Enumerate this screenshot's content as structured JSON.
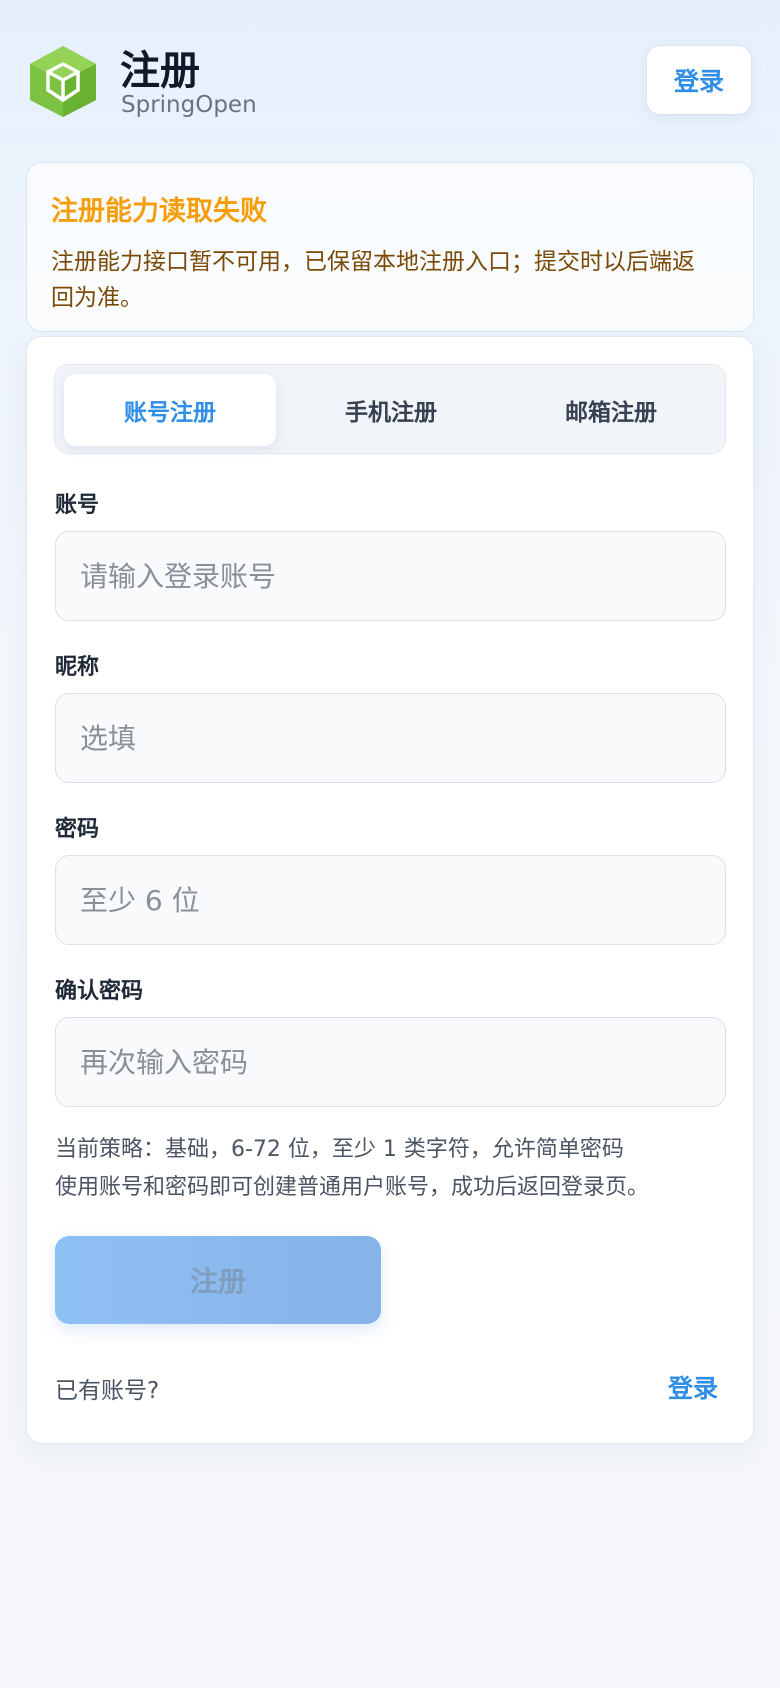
{
  "header": {
    "title": "注册",
    "subtitle": "SpringOpen",
    "login_label": "登录",
    "logo_icon": "cube-logo-icon"
  },
  "alert": {
    "title": "注册能力读取失败",
    "body_line1": "注册能力接口暂不可用，已保留本地注册入口；提交时以后端返",
    "body_line2": "回为准。"
  },
  "tabs": [
    {
      "label": "账号注册",
      "active": true
    },
    {
      "label": "手机注册",
      "active": false
    },
    {
      "label": "邮箱注册",
      "active": false
    }
  ],
  "form": {
    "account": {
      "label": "账号",
      "placeholder": "请输入登录账号",
      "value": ""
    },
    "nickname": {
      "label": "昵称",
      "placeholder": "选填",
      "value": ""
    },
    "password": {
      "label": "密码",
      "placeholder": "至少 6 位",
      "value": ""
    },
    "confirm": {
      "label": "确认密码",
      "placeholder": "再次输入密码",
      "value": ""
    }
  },
  "policy": {
    "line1": "当前策略：基础，6-72 位，至少 1 类字符，允许简单密码",
    "line2": "使用账号和密码即可创建普通用户账号，成功后返回登录页。"
  },
  "submit_label": "注册",
  "footer": {
    "text": "已有账号?",
    "link": "登录"
  },
  "colors": {
    "accent": "#2f8ee6",
    "warning": "#f59e0b",
    "logo_green": "#7cc242"
  }
}
